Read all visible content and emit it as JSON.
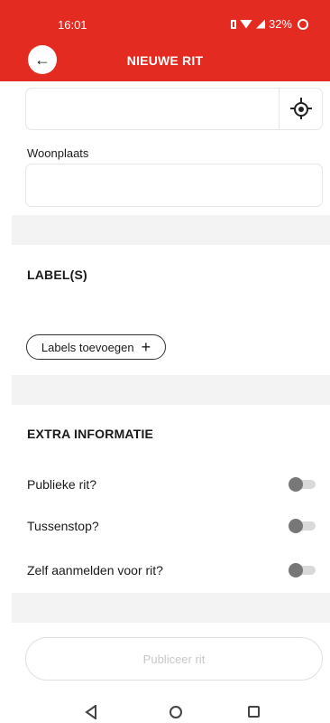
{
  "status": {
    "time": "16:01",
    "battery": "32%"
  },
  "appbar": {
    "title": "NIEUWE RIT",
    "back_icon": "arrow-left-icon"
  },
  "form": {
    "address_value": "",
    "woonplaats_label": "Woonplaats",
    "woonplaats_value": ""
  },
  "labels_section": {
    "title": "LABEL(S)",
    "add_button": "Labels toevoegen"
  },
  "extra_section": {
    "title": "EXTRA INFORMATIE",
    "toggles": [
      {
        "label": "Publieke rit?",
        "on": false
      },
      {
        "label": "Tussenstop?",
        "on": false
      },
      {
        "label": "Zelf aanmelden voor rit?",
        "on": false
      }
    ]
  },
  "publish_button": "Publiceer rit"
}
